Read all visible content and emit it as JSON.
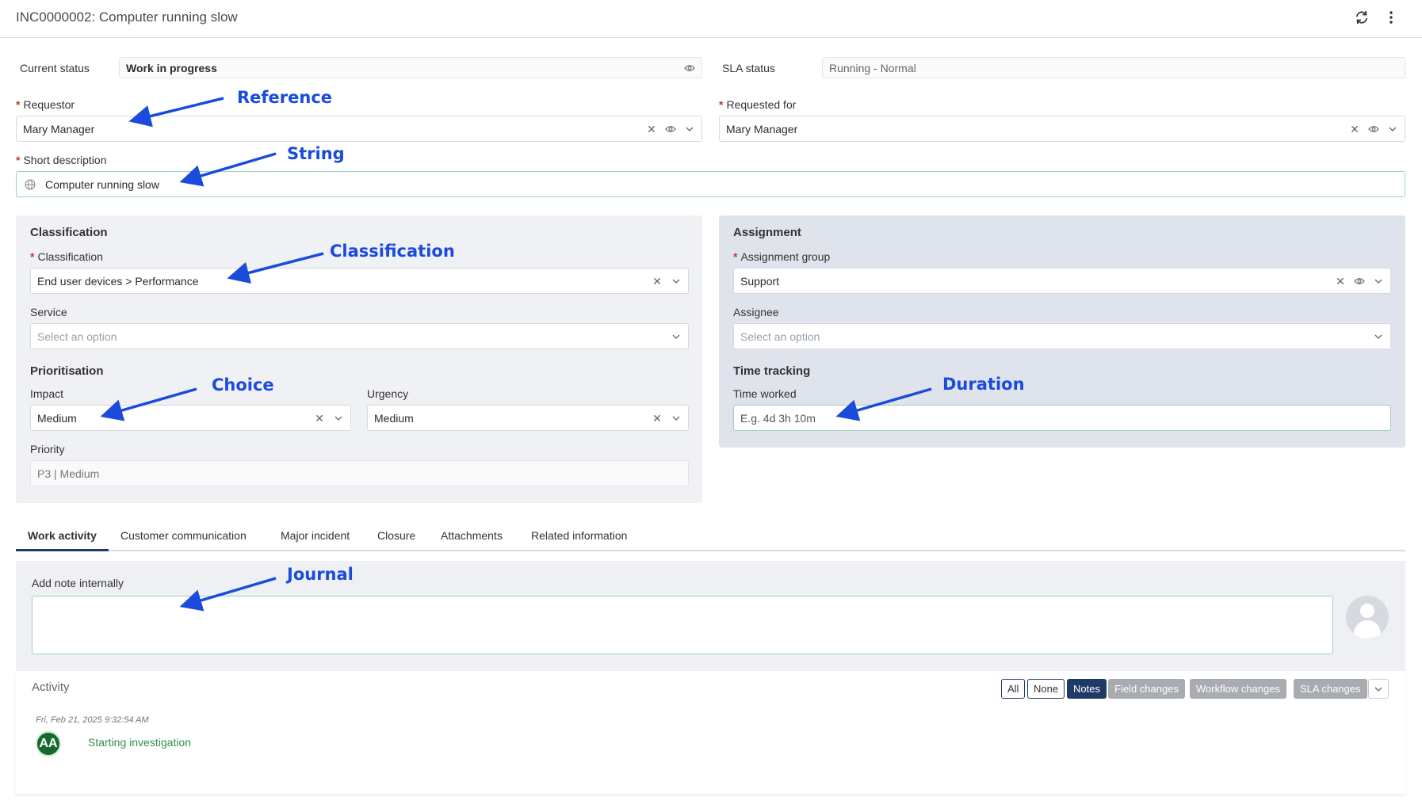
{
  "header": {
    "title": "INC0000002: Computer running slow"
  },
  "fields": {
    "current_status": {
      "label": "Current status",
      "value": "Work in progress"
    },
    "sla_status": {
      "label": "SLA status",
      "value": "Running - Normal"
    },
    "requestor": {
      "label": "Requestor",
      "value": "Mary Manager"
    },
    "requested_for": {
      "label": "Requested for",
      "value": "Mary Manager"
    },
    "short_description": {
      "label": "Short description",
      "value": "Computer running slow"
    }
  },
  "classification_panel": {
    "title": "Classification",
    "classification": {
      "label": "Classification",
      "value": "End user devices > Performance"
    },
    "service": {
      "label": "Service",
      "placeholder": "Select an option"
    },
    "prioritisation_title": "Prioritisation",
    "impact": {
      "label": "Impact",
      "value": "Medium"
    },
    "urgency": {
      "label": "Urgency",
      "value": "Medium"
    },
    "priority": {
      "label": "Priority",
      "value": "P3 | Medium"
    }
  },
  "assignment_panel": {
    "title": "Assignment",
    "assignment_group": {
      "label": "Assignment group",
      "value": "Support"
    },
    "assignee": {
      "label": "Assignee",
      "placeholder": "Select an option"
    },
    "time_tracking_title": "Time tracking",
    "time_worked": {
      "label": "Time worked",
      "placeholder": "E.g. 4d 3h 10m"
    }
  },
  "annotations": {
    "reference": "Reference",
    "string": "String",
    "classification": "Classification",
    "choice": "Choice",
    "duration": "Duration",
    "journal": "Journal"
  },
  "tabs": [
    {
      "label": "Work activity",
      "active": true
    },
    {
      "label": "Customer communication"
    },
    {
      "label": "Major incident"
    },
    {
      "label": "Closure"
    },
    {
      "label": "Attachments"
    },
    {
      "label": "Related information"
    }
  ],
  "journal": {
    "label": "Add note internally"
  },
  "activity": {
    "title": "Activity",
    "filters": [
      "All",
      "None",
      "Notes",
      "Field changes",
      "Workflow changes",
      "SLA changes"
    ],
    "entries": [
      {
        "date": "Fri, Feb 21, 2025 9:32:54 AM",
        "initials": "AA",
        "text": "Starting investigation"
      }
    ]
  },
  "colors": {
    "accent_navy": "#1e3a66",
    "annotation_blue": "#1a4bdc",
    "required_red": "#c0392b",
    "entry_green": "#2f8f4a"
  }
}
